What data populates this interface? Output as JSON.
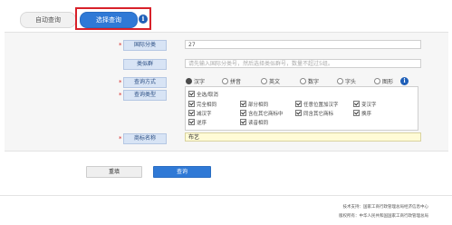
{
  "tabs": {
    "auto_query": "自动查询",
    "select_query": "选择查询"
  },
  "form": {
    "class_label": "国际分类",
    "class_value": "27",
    "group_label": "类似群",
    "group_placeholder": "请先输入国际分类号，然后选择类似群号，数量不超过5组。",
    "method_label": "查询方式",
    "methods": [
      {
        "label": "汉字",
        "selected": true
      },
      {
        "label": "拼音",
        "selected": false
      },
      {
        "label": "英文",
        "selected": false
      },
      {
        "label": "数字",
        "selected": false
      },
      {
        "label": "字头",
        "selected": false
      },
      {
        "label": "图形",
        "selected": false
      }
    ],
    "type_label": "查询类型",
    "types": [
      "全选/取消",
      "完全相同",
      "部分相同",
      "任意位置加汉字",
      "变汉字",
      "减汉字",
      "含在其它商标中",
      "同含其它商标",
      "换序",
      "逆序",
      "读音相同"
    ],
    "name_label": "商标名称",
    "name_value": "布艺"
  },
  "buttons": {
    "reset": "重填",
    "query": "查询"
  },
  "footer": {
    "line1": "技术支持：国家工商行政管理总局经济信息中心",
    "line2": "版权所有：中华人民共和国国家工商行政管理总局"
  },
  "colors": {
    "accent": "#2f79d6",
    "highlight_border": "#d8212a",
    "label_bg": "#d8e4f5",
    "name_field_bg": "#fffbd6"
  },
  "icons": [
    "info-icon",
    "radio-icon",
    "checkbox-icon"
  ]
}
